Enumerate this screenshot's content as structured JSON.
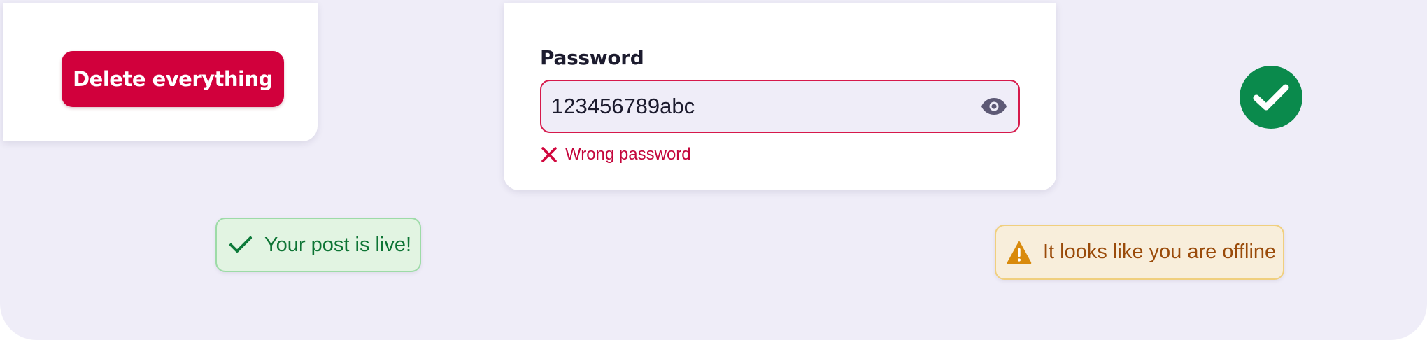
{
  "colors": {
    "background": "#efedf8",
    "danger": "#d1003c",
    "error_text": "#c4063c",
    "success_circle": "#0a8a4c",
    "success_toast_bg": "#e2f4e2",
    "success_toast_text": "#0d7434",
    "warning_toast_bg": "#f8eedb",
    "warning_toast_text": "#9a4b0a",
    "warning_icon": "#d98a0c"
  },
  "danger_card": {
    "button_label": "Delete everything"
  },
  "password_card": {
    "label": "Password",
    "value": "123456789abc",
    "reveal_icon": "eye-icon",
    "error_icon": "close-icon",
    "error_message": "Wrong password"
  },
  "success_badge": {
    "icon": "check-icon"
  },
  "toasts": {
    "success": {
      "icon": "check-icon",
      "message": "Your post is live!"
    },
    "warning": {
      "icon": "warning-icon",
      "message": "It looks like you are offline"
    }
  }
}
